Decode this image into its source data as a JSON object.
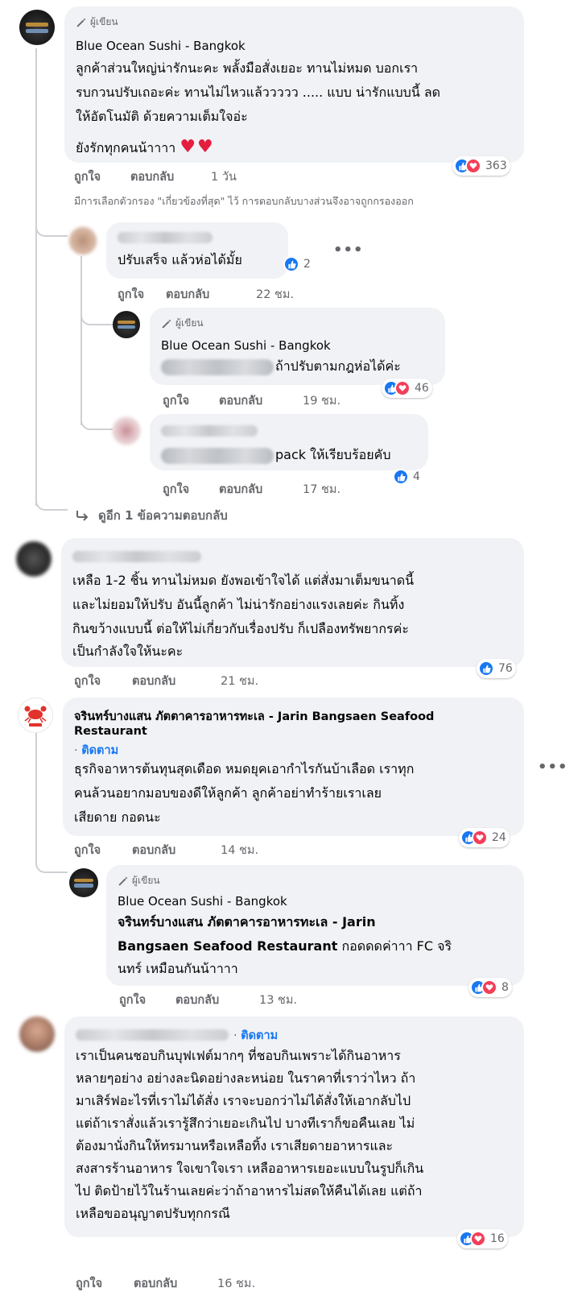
{
  "labels": {
    "author": "ผู้เขียน",
    "like": "ถูกใจ",
    "reply": "ตอบกลับ",
    "follow": "ติดตาม"
  },
  "filter_note": "มีการเลือกตัวกรอง \"เกี่ยวข้องที่สุด\" ไว้ การตอบกลับบางส่วนจึงอาจถูกกรองออก",
  "view_more": "ดูอีก 1 ข้อความตอบกลับ",
  "comments": [
    {
      "name": "Blue Ocean Sushi - Bangkok",
      "lines": [
        "ลูกค้าส่วนใหญ่น่ารักนะคะ พลั้งมือสั่งเยอะ ทานไม่หมด บอกเรา",
        "รบกวนปรับเถอะค่ะ ทานไม่ไหวแล้ววววว ..... แบบ น่ารักแบบนี้ ลด",
        "ให้อัตโนมัติ ด้วยความเต็มใจอ่ะ"
      ],
      "extra_line": "ยังรักทุกคนน้าาาา",
      "hearts": "♥♥",
      "time": "1 วัน",
      "reactions": "363",
      "replies": [
        {
          "text": "ปรับเสร็จ แล้วห่อได้มั้ย",
          "time": "22 ชม.",
          "reactions": "2"
        },
        {
          "name": "Blue Ocean Sushi - Bangkok",
          "text": "ถ้าปรับตามกฎห่อได้ค่ะ",
          "time": "19 ชม.",
          "reactions": "46"
        },
        {
          "text": "pack ให้เรียบร้อยคับ",
          "time": "17 ชม.",
          "reactions": "4"
        }
      ]
    },
    {
      "lines": [
        "เหลือ 1-2 ชิ้น ทานไม่หมด ยังพอเข้าใจได้ แต่สั่งมาเต็มขนาดนี้",
        "และไม่ยอมให้ปรับ อันนี้ลูกค้า ไม่น่ารักอย่างแรงเลยค่ะ กินทิ้ง",
        "กินขว้างแบบนี้ ต่อให้ไม่เกี่ยวกับเรื่องปรับ ก็เปลืองทรัพยากรค่ะ",
        "เป็นกำลังใจให้นะคะ"
      ],
      "time": "21 ชม.",
      "reactions": "76"
    },
    {
      "name_line1": "จรินทร์บางแสน ภัตตาคารอาหารทะเล - Jarin Bangsaen Seafood",
      "name_line2": "Restaurant",
      "lines": [
        "ธุรกิจอาหารต้นทุนสุดเดือด หมดยุคเอากำไรกันบ้าเลือด เราทุก",
        "คนล้วนอยากมอบของดีให้ลูกค้า ลูกค้าอย่าทำร้ายเราเลย",
        "เสียดาย กอดนะ"
      ],
      "time": "14 ชม.",
      "reactions": "24",
      "reply": {
        "name": "Blue Ocean Sushi - Bangkok",
        "mention_line1": "จรินทร์บางแสน ภัตตาคารอาหารทะเล - Jarin",
        "mention_line2_bold": "Bangsaen Seafood Restaurant",
        "text_line2_rest": "กอดดดค่าาา FC จริ",
        "text_line3": "นทร์ เหมือนกันน้าาาา",
        "time": "13 ชม.",
        "reactions": "8"
      }
    },
    {
      "lines": [
        "เราเป็นคนชอบกินบุฟเฟต์มากๆ ที่ชอบกินเพราะได้กินอาหาร",
        "หลายๆอย่าง อย่างละนิดอย่างละหน่อย ในราคาที่เราว่าไหว ถ้า",
        "มาเสิร์ฟอะไรที่เราไม่ได้สั่ง เราจะบอกว่าไม่ได้สั่งให้เอากลับไป",
        "แต่ถ้าเราสั่งแล้วเรารู้สึกว่าเยอะเกินไป บางทีเราก็ขอคืนเลย ไม่",
        "ต้องมานั่งกินให้ทรมานหรือเหลือทิ้ง เราเสียดายอาหารและ",
        "สงสารร้านอาหาร ใจเขาใจเรา เหลืออาหารเยอะแบบในรูปก็เกิน",
        "ไป ติดป้ายไว้ในร้านเลยค่ะว่าถ้าอาหารไม่สดให้คืนได้เลย แต่ถ้า",
        "เหลือขออนุญาตปรับทุกกรณี"
      ],
      "time": "16 ชม.",
      "reactions": "16"
    }
  ]
}
